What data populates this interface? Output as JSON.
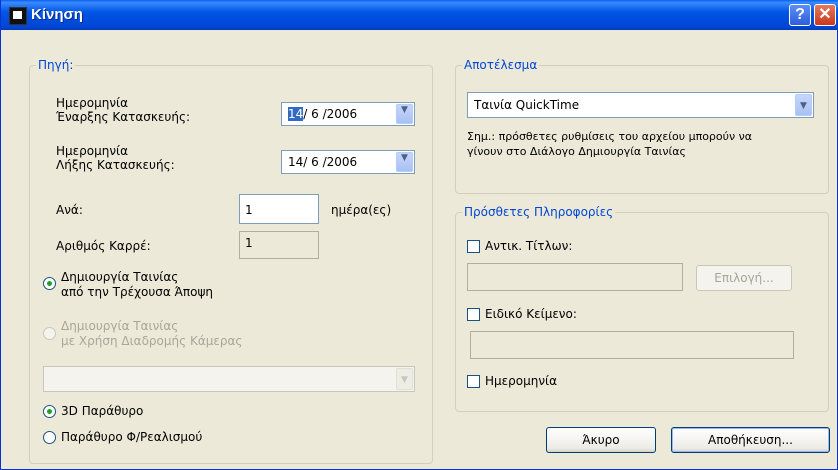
{
  "window": {
    "title": "Κίνηση",
    "help_label": "?",
    "close_label": "✕"
  },
  "source": {
    "legend": "Πηγή:",
    "start_date_label_1": "Ημερομηνία",
    "start_date_label_2": "Έναρξης Κατασκευής:",
    "start_date": {
      "day": "14",
      "rest": "/ 6 /2006"
    },
    "end_date_label_1": "Ημερομηνία",
    "end_date_label_2": "Λήξης Κατασκευής:",
    "end_date": "14/ 6 /2006",
    "every_label": "Ανά:",
    "every_value": "1",
    "every_unit": "ημέρα(ες)",
    "frames_label": "Αριθμός Καρρέ:",
    "frames_value": "1",
    "opt_current_view_1": "Δημιουργία Ταινίας",
    "opt_current_view_2": "από την Τρέχουσα Άποψη",
    "opt_camera_path_1": "Δημιουργία Ταινίας",
    "opt_camera_path_2": "με Χρήση Διαδρομής Κάμερας",
    "camera_path_value": "",
    "opt_3d_window": "3D Παράθυρο",
    "opt_photo_window": "Παράθυρο Φ/Ρεαλισμού"
  },
  "result": {
    "legend": "Αποτέλεσμα",
    "format_value": "Ταινία QuickTime",
    "note_1": "Σημ.: πρόσθετες ρυθμίσεις του αρχείου μπορούν να",
    "note_2": "γίνουν στο Διάλογο Δημιουργία Ταινίας"
  },
  "extra": {
    "legend": "Πρόσθετες Πληροφορίες",
    "titles_label": "Αντικ. Τίτλων:",
    "titles_value": "",
    "select_button": "Επιλογή...",
    "custom_text_label": "Ειδικό Κείμενο:",
    "custom_text_value": "",
    "date_label": "Ημερομηνία"
  },
  "buttons": {
    "cancel": "Άκυρο",
    "save": "Αποθήκευση..."
  },
  "colors": {
    "title_bar": "#0055E5",
    "legend_text": "#0046D5",
    "face": "#ECE9D8",
    "radio_dot": "#21A121"
  }
}
